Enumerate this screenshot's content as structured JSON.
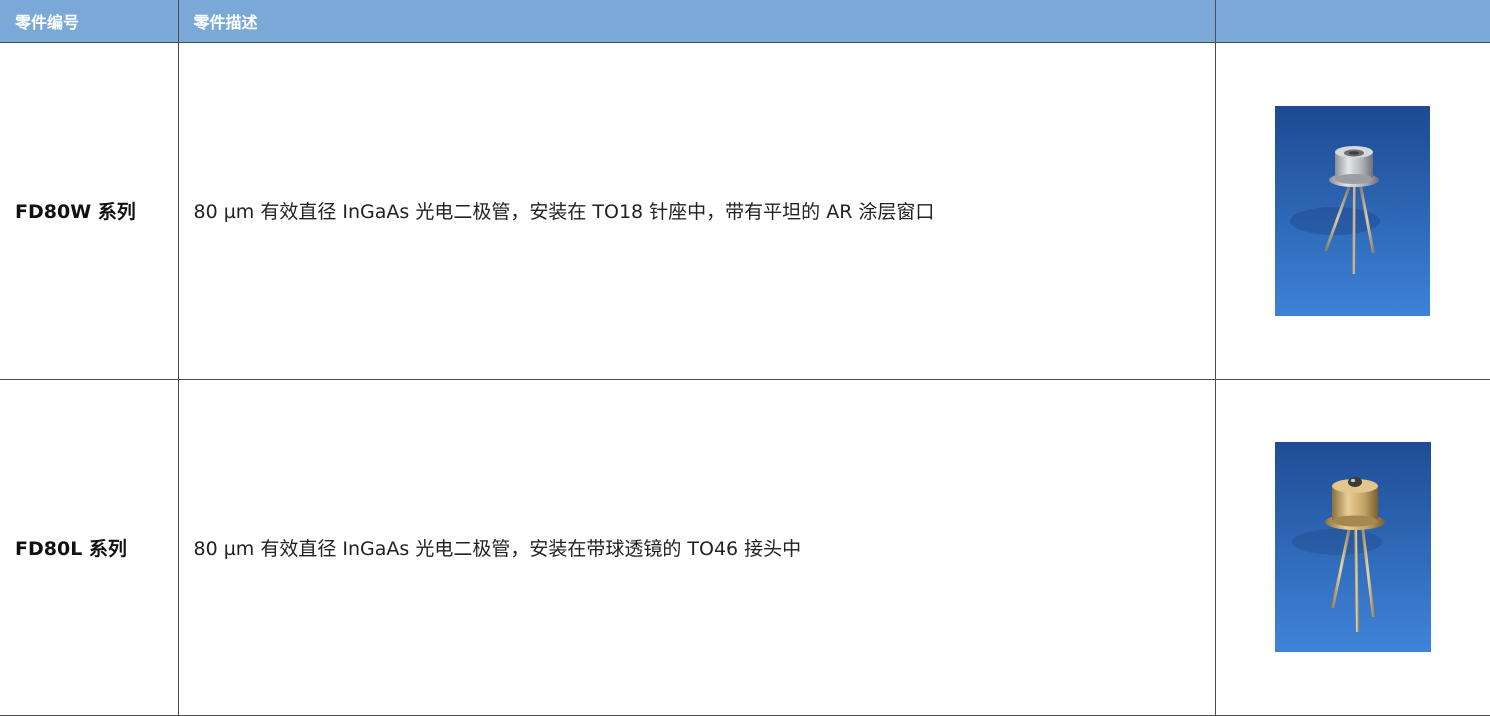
{
  "table": {
    "headers": [
      "零件编号",
      "零件描述",
      ""
    ],
    "rows": [
      {
        "part": "FD80W 系列",
        "description": "80 µm 有效直径 InGaAs 光电二极管，安装在 TO18 针座中，带有平坦的 AR 涂层窗口",
        "image_icon": "to18-photodiode-photo"
      },
      {
        "part": "FD80L 系列",
        "description": "80 µm 有效直径 InGaAs 光电二极管，安装在带球透镜的 TO46 接头中",
        "image_icon": "to46-photodiode-photo"
      }
    ]
  },
  "colors": {
    "header_bg": "#7aa9d8",
    "header_text": "#ffffff",
    "border": "#4d4d4d",
    "photo_bg_top": "#1f4f9a",
    "photo_bg_bottom": "#3f84d9"
  }
}
